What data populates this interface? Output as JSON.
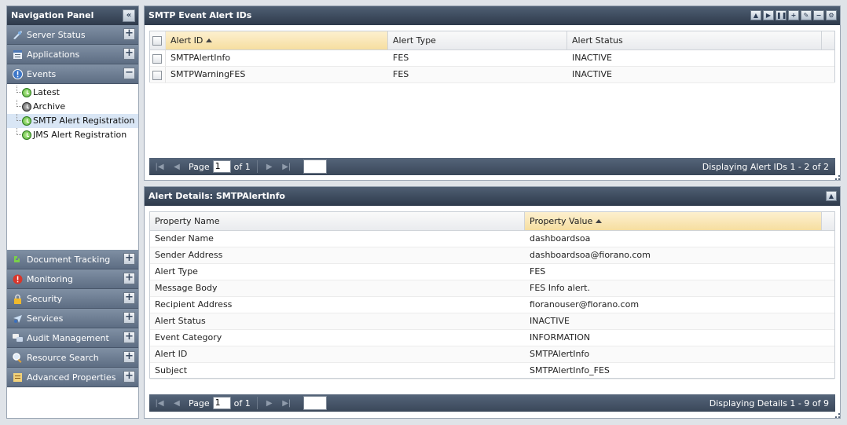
{
  "nav": {
    "title": "Navigation Panel",
    "top_sections": [
      {
        "label": "Server Status",
        "icon": "server-status-icon",
        "expanded": false
      },
      {
        "label": "Applications",
        "icon": "applications-icon",
        "expanded": false
      },
      {
        "label": "Events",
        "icon": "events-icon",
        "expanded": true
      }
    ],
    "events_items": [
      {
        "label": "Latest",
        "icon": "latest-event-icon"
      },
      {
        "label": "Archive",
        "icon": "archive-event-icon"
      },
      {
        "label": "SMTP Alert Registration",
        "icon": "smtp-alert-icon",
        "selected": true
      },
      {
        "label": "JMS Alert Registration",
        "icon": "jms-alert-icon"
      }
    ],
    "bottom_sections": [
      {
        "label": "Document Tracking",
        "icon": "document-tracking-icon"
      },
      {
        "label": "Monitoring",
        "icon": "monitoring-icon"
      },
      {
        "label": "Security",
        "icon": "security-icon"
      },
      {
        "label": "Services",
        "icon": "services-icon"
      },
      {
        "label": "Audit Management",
        "icon": "audit-management-icon"
      },
      {
        "label": "Resource Search",
        "icon": "resource-search-icon"
      },
      {
        "label": "Advanced Properties",
        "icon": "advanced-properties-icon"
      }
    ]
  },
  "alert_ids": {
    "title": "SMTP Event Alert IDs",
    "columns": [
      "Alert ID",
      "Alert Type",
      "Alert Status"
    ],
    "rows": [
      {
        "id": "SMTPAlertInfo",
        "type": "FES",
        "status": "INACTIVE"
      },
      {
        "id": "SMTPWarningFES",
        "type": "FES",
        "status": "INACTIVE"
      }
    ],
    "pager": {
      "page_label": "Page",
      "page": "1",
      "of_label": "of 1",
      "status": "Displaying Alert IDs 1 - 2 of 2"
    }
  },
  "details": {
    "title": "Alert Details: SMTPAlertInfo",
    "columns": [
      "Property Name",
      "Property Value"
    ],
    "rows": [
      {
        "name": "Sender Name",
        "value": "dashboardsoa"
      },
      {
        "name": "Sender Address",
        "value": "dashboardsoa@fiorano.com"
      },
      {
        "name": "Alert Type",
        "value": "FES"
      },
      {
        "name": "Message Body",
        "value": "FES Info alert."
      },
      {
        "name": "Recipient Address",
        "value": "fioranouser@fiorano.com"
      },
      {
        "name": "Alert Status",
        "value": "INACTIVE"
      },
      {
        "name": "Event Category",
        "value": "INFORMATION"
      },
      {
        "name": "Alert ID",
        "value": "SMTPAlertInfo"
      },
      {
        "name": "Subject",
        "value": "SMTPAlertInfo_FES"
      }
    ],
    "pager": {
      "page_label": "Page",
      "page": "1",
      "of_label": "of 1",
      "status": "Displaying Details 1 - 9 of 9"
    }
  }
}
